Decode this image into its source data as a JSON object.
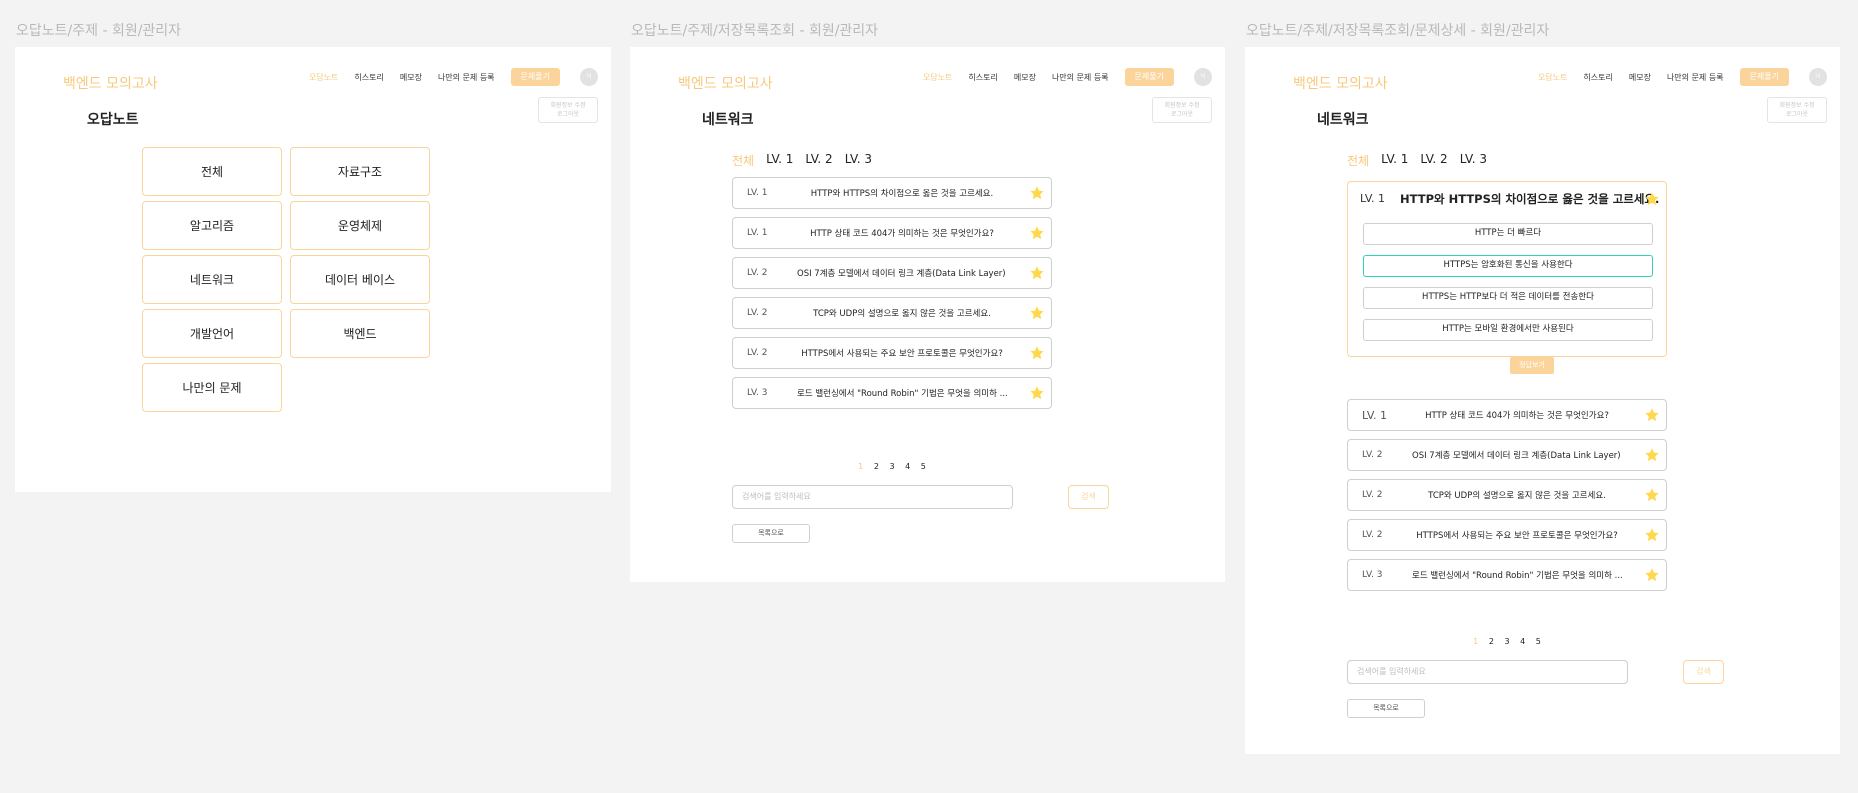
{
  "app": {
    "logo": "백엔드 모의고사",
    "nav": [
      "오답노트",
      "히스토리",
      "메모장",
      "나만의 문제 등록"
    ],
    "nav_button": "문제풀기",
    "avatar": "닉",
    "profile_popup": [
      "회원정보 수정",
      "로그아웃"
    ],
    "accent_color": "#f7c97d"
  },
  "frames": [
    {
      "label": "오답노트/주제 - 회원/관리자",
      "page_title": "오답노트",
      "categories": [
        "전체",
        "자료구조",
        "알고리즘",
        "운영체제",
        "네트워크",
        "데이터 베이스",
        "개발언어",
        "백엔드",
        "나만의 문제"
      ]
    },
    {
      "label": "오답노트/주제/저장목록조회  - 회원/관리자",
      "page_title": "네트워크"
    },
    {
      "label": "오답노트/주제/저장목록조회/문제상세  - 회원/관리자",
      "page_title": "네트워크"
    }
  ],
  "level_tabs": [
    "전체",
    "LV. 1",
    "LV. 2",
    "LV. 3"
  ],
  "questions": [
    {
      "level": "LV. 1",
      "text": "HTTP와 HTTPS의 차이점으로 옳은 것을 고르세요."
    },
    {
      "level": "LV. 1",
      "text": "HTTP 상태 코드 404가 의미하는 것은 무엇인가요?"
    },
    {
      "level": "LV. 2",
      "text": "OSI 7계층 모델에서 데이터 링크 계층(Data Link Layer) ..."
    },
    {
      "level": "LV. 2",
      "text": "TCP와 UDP의 설명으로 옳지 않은 것을 고르세요."
    },
    {
      "level": "LV. 2",
      "text": "HTTPS에서 사용되는 주요 보안 프로토콜은 무엇인가요?"
    },
    {
      "level": "LV. 3",
      "text": "로드 밸런싱에서 \"Round Robin\" 기법은 무엇을 의미하 ..."
    }
  ],
  "detail": {
    "level": "LV. 1",
    "question": "HTTP와 HTTPS의 차이점으로 옳은 것을 고르세요.",
    "choices": [
      "HTTP는 더 빠르다",
      "HTTPS는 암호화된 통신을 사용한다",
      "HTTPS는 HTTP보다 더 적은 데이터를 전송한다",
      "HTTP는 모바일 환경에서만 사용된다"
    ],
    "selected_index": 1,
    "answer_button": "정답보기"
  },
  "pagination": [
    "1",
    "2",
    "3",
    "4",
    "5"
  ],
  "search": {
    "placeholder": "검색어를 입력하세요",
    "button": "검색"
  },
  "list_button": "목록으로",
  "colors": {
    "star": "#ffd84d",
    "selected_choice": "#2ed3b7",
    "card_border": "#fbd49b"
  }
}
